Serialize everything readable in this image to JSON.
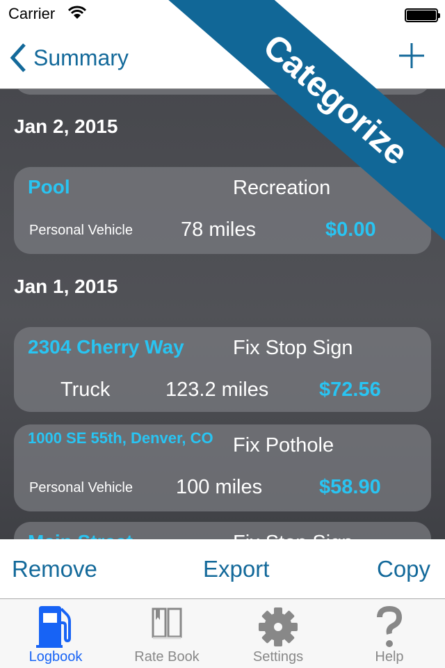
{
  "status": {
    "carrier": "Carrier"
  },
  "nav": {
    "back_label": "Summary",
    "add_icon": "plus-icon"
  },
  "banner": {
    "label": "Categorize",
    "color": "#116797"
  },
  "colors": {
    "accent": "#13699a",
    "link": "#29c4f2",
    "tab_active": "#1763f5"
  },
  "sections": [
    {
      "date": "Jan 2, 2015",
      "trips": [
        {
          "name": "Pool",
          "category": "Recreation",
          "vehicle": "Personal Vehicle",
          "miles": "78 miles",
          "amount": "$0.00"
        }
      ]
    },
    {
      "date": "Jan 1, 2015",
      "trips": [
        {
          "name": "2304 Cherry Way",
          "category": "Fix Stop Sign",
          "vehicle": "Truck",
          "miles": "123.2 miles",
          "amount": "$72.56"
        },
        {
          "name": "1000 SE 55th, Denver, CO",
          "category": "Fix Pothole",
          "vehicle": "Personal Vehicle",
          "miles": "100 miles",
          "amount": "$58.90"
        },
        {
          "name": "Main Street",
          "category": "Fix Stop Sign"
        }
      ]
    }
  ],
  "actions": {
    "remove": "Remove",
    "export": "Export",
    "copy": "Copy"
  },
  "tabs": [
    {
      "label": "Logbook",
      "icon": "gas-pump-icon",
      "active": true
    },
    {
      "label": "Rate Book",
      "icon": "book-icon"
    },
    {
      "label": "Settings",
      "icon": "gear-icon"
    },
    {
      "label": "Help",
      "icon": "question-icon"
    }
  ]
}
